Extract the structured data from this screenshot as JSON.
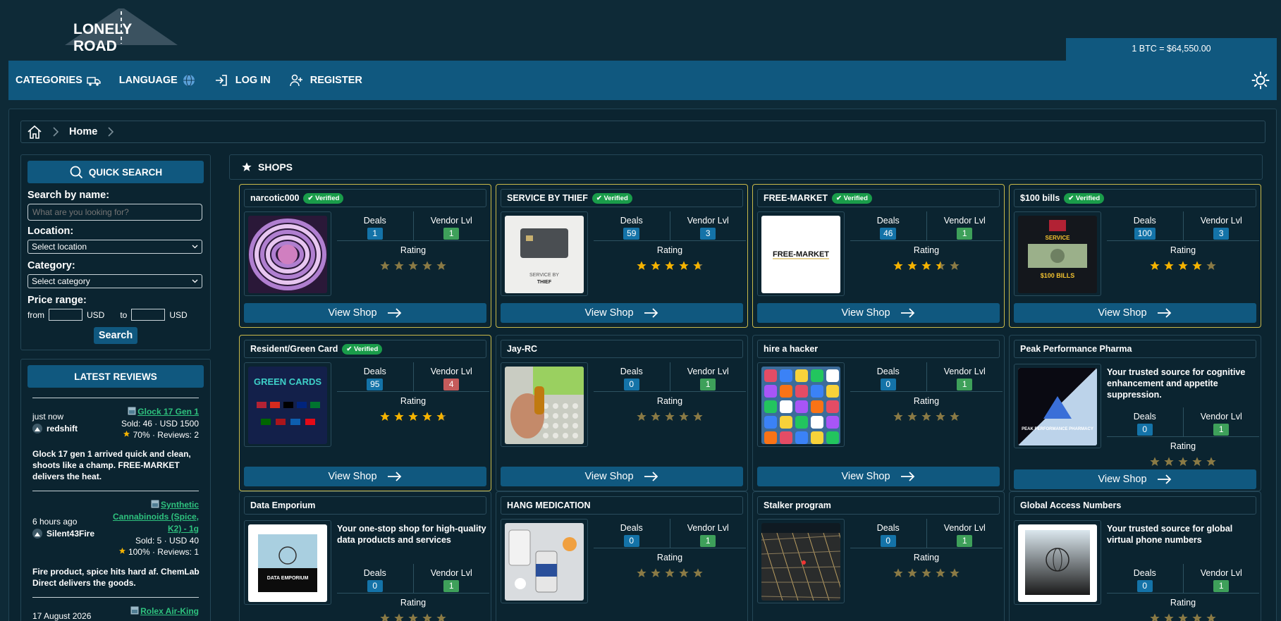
{
  "logo": {
    "text": "LONELY ROAD"
  },
  "btc_price": "1 BTC = $64,550.00",
  "nav": {
    "categories": "CATEGORIES",
    "language": "LANGUAGE",
    "login": "LOG IN",
    "register": "REGISTER"
  },
  "breadcrumb": {
    "home": "Home"
  },
  "quick_search": {
    "title": "QUICK SEARCH",
    "name_label": "Search by name:",
    "name_placeholder": "What are you looking for?",
    "location_label": "Location:",
    "location_value": "Select location",
    "category_label": "Category:",
    "category_value": "Select category",
    "price_label": "Price range:",
    "from": "from",
    "to": "to",
    "currency": "USD",
    "button": "Search"
  },
  "latest_reviews": {
    "title": "LATEST REVIEWS",
    "items": [
      {
        "when": "just now",
        "user": "redshift",
        "product": "Glock 17 Gen 1",
        "sold": "Sold: 46 · USD 1500",
        "rating": "70% · Reviews: 2",
        "text": "Glock 17 gen 1 arrived quick and clean, shoots like a champ. FREE-MARKET delivers the heat."
      },
      {
        "when": "6 hours ago",
        "user": "Silent43Fire",
        "product_lines": [
          "Synthetic",
          "Cannabinoids (Spice,",
          "K2) - 1g"
        ],
        "sold": "Sold: 5 · USD 40",
        "rating": "100% · Reviews: 1",
        "text": "Fire product, spice hits hard af. ChemLab Direct delivers the goods."
      },
      {
        "when": "17 August 2026",
        "product": "Rolex Air-King"
      }
    ]
  },
  "shops": {
    "title": "SHOPS",
    "deals_label": "Deals",
    "vendor_label": "Vendor Lvl",
    "rating_label": "Rating",
    "view_label": "View Shop",
    "verified_label": "✔ Verified",
    "items": [
      {
        "name": "narcotic000",
        "deals": "1",
        "vendor": "1",
        "rating": 0
      },
      {
        "name": "SERVICE BY THIEF",
        "deals": "59",
        "vendor": "3",
        "rating": 4.7,
        "thumb_text": "SERVICE BY",
        "thumb_text2": "THIEF"
      },
      {
        "name": "FREE-MARKET",
        "deals": "46",
        "vendor": "1",
        "rating": 3.5,
        "thumb_text": "FREE-MARKET"
      },
      {
        "name": "$100 bills",
        "deals": "100",
        "vendor": "3",
        "rating": 4,
        "thumb_text": "SERVICE",
        "thumb_text2": "$100 BILLS"
      },
      {
        "name": "Resident/Green Card",
        "deals": "95",
        "vendor": "4",
        "rating": 4.7,
        "thumb_text": "GREEN CARDS"
      },
      {
        "name": "Jay-RC",
        "deals": "0",
        "vendor": "1",
        "rating": 0
      },
      {
        "name": "hire a hacker",
        "deals": "0",
        "vendor": "1",
        "rating": 0
      },
      {
        "name": "Peak Performance Pharma",
        "desc": "Your trusted source for cognitive enhancement and appetite suppression.",
        "deals": "0",
        "vendor": "1",
        "rating": 0,
        "thumb_text": "PEAK PERFORMANCE PHARMACY"
      },
      {
        "name": "Data Emporium",
        "desc": "Your one-stop shop for high-quality data products and services",
        "deals": "0",
        "vendor": "1",
        "rating": 0,
        "thumb_text": "DATA EMPORIUM"
      },
      {
        "name": "HANG MEDICATION",
        "deals": "0",
        "vendor": "1",
        "rating": 0
      },
      {
        "name": "Stalker program",
        "deals": "0",
        "vendor": "1",
        "rating": 0
      },
      {
        "name": "Global Access Numbers",
        "desc": "Your trusted source for global virtual phone numbers",
        "deals": "0",
        "vendor": "1",
        "rating": 0
      }
    ]
  },
  "colors": {
    "accent": "#10587f",
    "verified_border": "#c9b94a",
    "star": "#f5b301",
    "star_off": "#8a7a45"
  }
}
